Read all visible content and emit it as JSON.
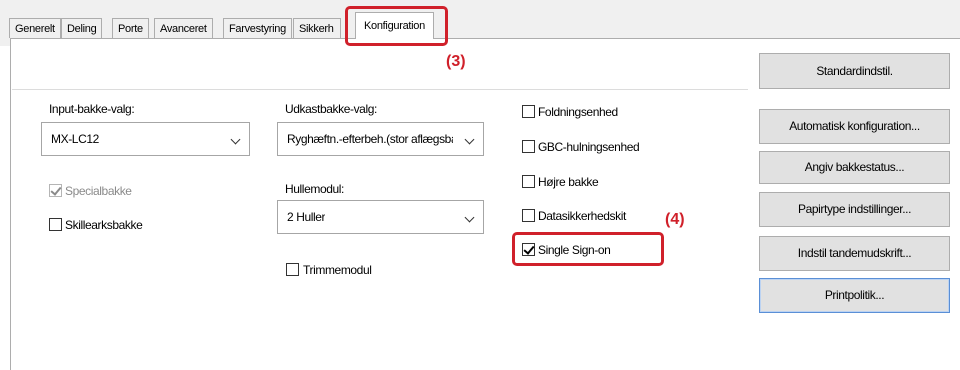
{
  "tabs": [
    {
      "label": "Generelt"
    },
    {
      "label": "Deling"
    },
    {
      "label": "Porte"
    },
    {
      "label": "Avanceret"
    },
    {
      "label": "Farvestyring"
    },
    {
      "label": "Sikkerh"
    },
    {
      "label": "Konfiguration",
      "active": true
    }
  ],
  "annotations": {
    "step3": "(3)",
    "step4": "(4)",
    "highlight_color": "#d0202a"
  },
  "input_tray": {
    "label": "Input-bakke-valg:",
    "value": "MX-LC12"
  },
  "output_tray": {
    "label": "Udkastbakke-valg:",
    "value": "Ryghæftn.-efterbeh.(stor aflægsba"
  },
  "hole_module": {
    "label": "Hullemodul:",
    "value": "2 Huller"
  },
  "checkboxes": {
    "special_tray": {
      "label": "Specialbakke",
      "checked": true,
      "disabled": true
    },
    "separator_tray": {
      "label": "Skillearksbakke",
      "checked": false
    },
    "trim_module": {
      "label": "Trimmemodul",
      "checked": false
    },
    "folding_unit": {
      "label": "Foldningsenhed",
      "checked": false
    },
    "gbc_punch": {
      "label": "GBC-hulningsenhed",
      "checked": false
    },
    "right_tray": {
      "label": "Højre bakke",
      "checked": false
    },
    "data_security_kit": {
      "label": "Datasikkerhedskit",
      "checked": false
    },
    "single_sign_on": {
      "label": "Single Sign-on",
      "checked": true
    }
  },
  "buttons": {
    "default": "Standardindstil.",
    "auto_config": "Automatisk konfiguration...",
    "tray_status": "Angiv bakkestatus...",
    "paper_type": "Papirtype indstillinger...",
    "tandem": "Indstil tandemudskrift...",
    "print_policy": "Printpolitik..."
  }
}
